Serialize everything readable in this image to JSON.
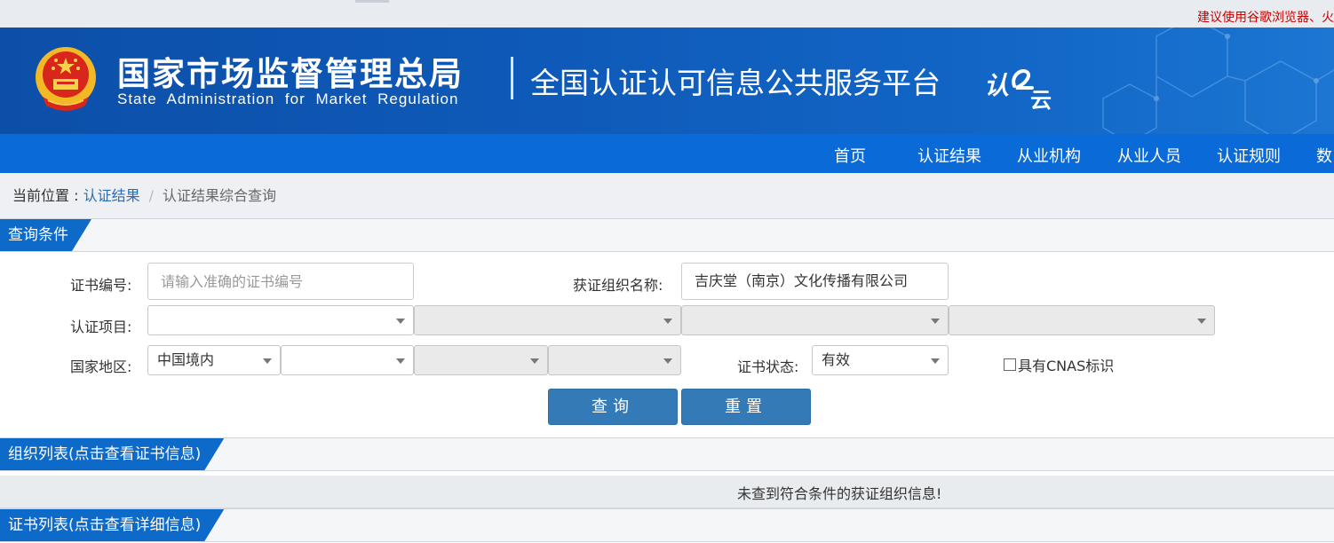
{
  "top_notice": {
    "text": "建议使用谷歌浏览器、火"
  },
  "header": {
    "org_name_cn": "国家市场监督管理总局",
    "org_name_en": "State Administration  for  Market Regulation",
    "platform_title": "全国认证认可信息公共服务平台",
    "logo_text": "认",
    "logo_sub": "云",
    "colors": {
      "banner": "#0f5bba",
      "nav": "#0a6ad8",
      "accent": "#0e6ac8",
      "button": "#337ab7"
    }
  },
  "nav": {
    "items": [
      "首页",
      "认证结果",
      "从业机构",
      "从业人员",
      "认证规则",
      "数"
    ]
  },
  "breadcrumb": {
    "prefix": "当前位置 : ",
    "link": "认证结果",
    "separator": "/",
    "current": "认证结果综合查询"
  },
  "query": {
    "section_title": "查询条件",
    "cert_no_label": "证书编号:",
    "cert_no_placeholder": "请输入准确的证书编号",
    "cert_no_value": "",
    "org_label": "获证组织名称:",
    "org_value": "吉庆堂（南京）文化传播有限公司",
    "project_label": "认证项目:",
    "project_selects": [
      "",
      "",
      "",
      ""
    ],
    "region_label": "国家地区:",
    "region_selects": [
      "中国境内",
      "",
      "",
      ""
    ],
    "status_label": "证书状态:",
    "status_value": "有效",
    "cnas_label": "具有CNAS标识",
    "search_button": "查询",
    "reset_button": "重置"
  },
  "org_list": {
    "section_title": "组织列表(点击查看证书信息)",
    "empty_message": "未查到符合条件的获证组织信息!"
  },
  "cert_list": {
    "section_title": "证书列表(点击查看详细信息)"
  }
}
